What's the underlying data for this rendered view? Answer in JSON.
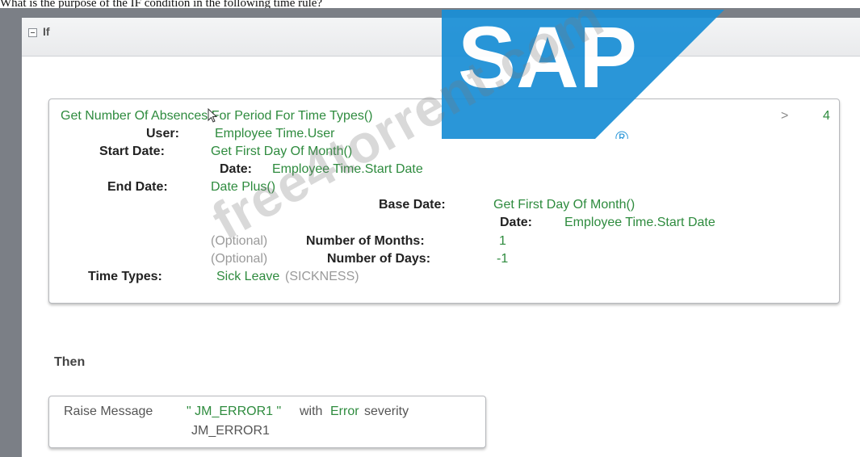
{
  "question": "What is the purpose of the IF condition in the following time rule?",
  "header": {
    "label": "If"
  },
  "condition": {
    "function": "Get Number Of Absences For Period For Time Types()",
    "operator": ">",
    "compare_value": "4",
    "user_label": "User:",
    "user_value": "Employee Time.User",
    "start_date_label": "Start Date:",
    "start_date_value": "Get First Day Of Month()",
    "start_sub_label": "Date:",
    "start_sub_value": "Employee Time.Start Date",
    "end_date_label": "End Date:",
    "end_date_value": "Date Plus()",
    "base_date_label": "Base Date:",
    "base_date_value": "Get First Day Of Month()",
    "base_sub_label": "Date:",
    "base_sub_value": "Employee Time.Start Date",
    "optional_1": "(Optional)",
    "months_label": "Number of Months:",
    "months_value": "1",
    "optional_2": "(Optional)",
    "days_label": "Number of Days:",
    "days_value": "-1",
    "time_types_label": "Time Types:",
    "time_types_value": "Sick Leave",
    "time_types_code": "(SICKNESS)"
  },
  "then": {
    "label": "Then"
  },
  "action": {
    "prefix": "Raise Message",
    "message": "\" JM_ERROR1 \"",
    "with_word": "with",
    "severity_word": "Error",
    "severity_suffix": "severity",
    "message_id": "JM_ERROR1"
  },
  "overlay": {
    "logo_text": "SAP",
    "registered_mark": "®",
    "watermark_text": "free4torrent.com"
  },
  "colors": {
    "value_green": "#2e8b3e",
    "label_dark": "#222222",
    "optional_gray": "#9a9a9a",
    "frame_gray": "#7b7f86",
    "sap_blue": "#1a8fd6"
  }
}
